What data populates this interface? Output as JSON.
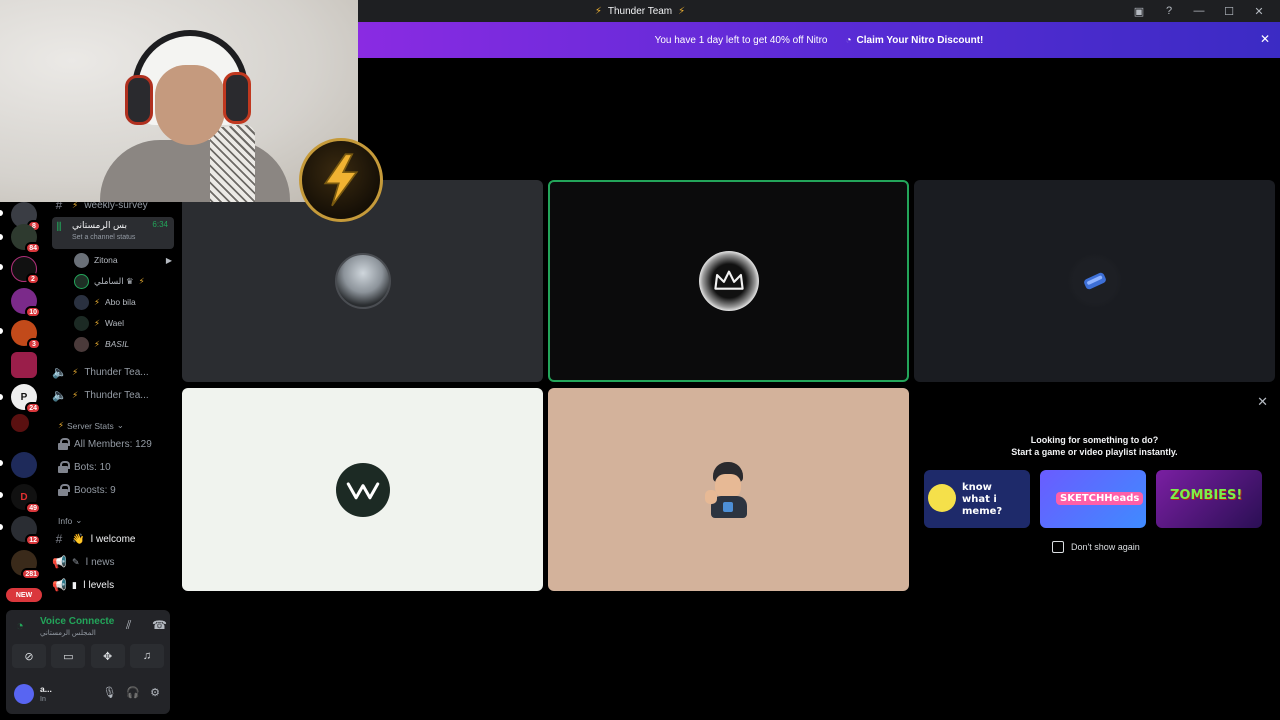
{
  "titlebar": {
    "title": "Thunder Team"
  },
  "banner": {
    "message": "You have 1 day left to get 40% off Nitro",
    "cta": "Claim Your Nitro Discount!"
  },
  "servers": [
    {
      "badge": "8"
    },
    {
      "badge": "84"
    },
    {
      "badge": "2"
    },
    {
      "badge": "10"
    },
    {
      "badge": "3"
    },
    {
      "badge": ""
    },
    {
      "badge": "24"
    },
    {
      "badge": ""
    },
    {
      "badge": ""
    },
    {
      "badge": "49"
    },
    {
      "badge": "12"
    },
    {
      "badge": "281"
    }
  ],
  "new_badge": "NEW",
  "channels": {
    "weekly_survey": "weekly-survey",
    "active_voice": {
      "name": "بس الرمستاني",
      "time": "6:34",
      "status": "Set a channel status"
    },
    "voice_users": [
      "Zitona",
      "الساملي ♛",
      "Abo bila",
      "Wael",
      "BASIL"
    ],
    "voice_channels": [
      "Thunder Tea...",
      "Thunder Tea..."
    ],
    "server_stats": {
      "category": "Server Stats",
      "items": [
        "All Members: 129",
        "Bots: 10",
        "Boosts: 9"
      ]
    },
    "info": {
      "category": "Info",
      "items": [
        "welcome",
        "news",
        "levels"
      ]
    }
  },
  "voice_panel": {
    "status": "Voice Connected",
    "channel": "المجلس الرمستاني"
  },
  "user_panel": {
    "name": "a...",
    "status": "In"
  },
  "promo": {
    "line1": "Looking for something to do?",
    "line2": "Start a game or video playlist instantly.",
    "games": [
      "know what i meme?",
      "SKETCHHeads",
      "ZOMBIES!"
    ],
    "checkbox_label": "Don't show again"
  }
}
